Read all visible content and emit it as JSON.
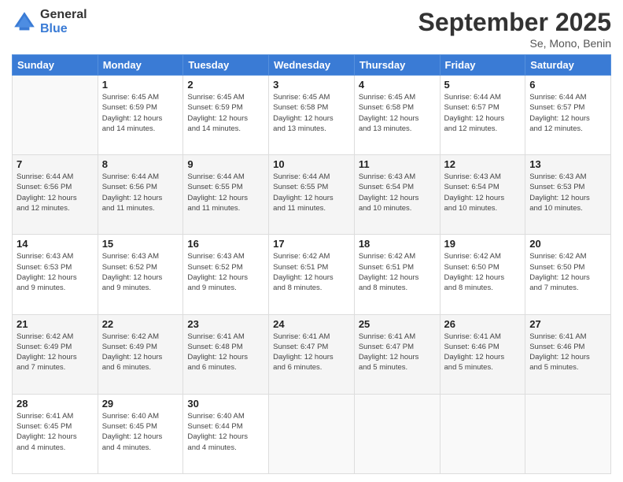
{
  "logo": {
    "general": "General",
    "blue": "Blue"
  },
  "header": {
    "month": "September 2025",
    "location": "Se, Mono, Benin"
  },
  "weekdays": [
    "Sunday",
    "Monday",
    "Tuesday",
    "Wednesday",
    "Thursday",
    "Friday",
    "Saturday"
  ],
  "weeks": [
    [
      {
        "day": "",
        "info": ""
      },
      {
        "day": "1",
        "info": "Sunrise: 6:45 AM\nSunset: 6:59 PM\nDaylight: 12 hours\nand 14 minutes."
      },
      {
        "day": "2",
        "info": "Sunrise: 6:45 AM\nSunset: 6:59 PM\nDaylight: 12 hours\nand 14 minutes."
      },
      {
        "day": "3",
        "info": "Sunrise: 6:45 AM\nSunset: 6:58 PM\nDaylight: 12 hours\nand 13 minutes."
      },
      {
        "day": "4",
        "info": "Sunrise: 6:45 AM\nSunset: 6:58 PM\nDaylight: 12 hours\nand 13 minutes."
      },
      {
        "day": "5",
        "info": "Sunrise: 6:44 AM\nSunset: 6:57 PM\nDaylight: 12 hours\nand 12 minutes."
      },
      {
        "day": "6",
        "info": "Sunrise: 6:44 AM\nSunset: 6:57 PM\nDaylight: 12 hours\nand 12 minutes."
      }
    ],
    [
      {
        "day": "7",
        "info": "Sunrise: 6:44 AM\nSunset: 6:56 PM\nDaylight: 12 hours\nand 12 minutes."
      },
      {
        "day": "8",
        "info": "Sunrise: 6:44 AM\nSunset: 6:56 PM\nDaylight: 12 hours\nand 11 minutes."
      },
      {
        "day": "9",
        "info": "Sunrise: 6:44 AM\nSunset: 6:55 PM\nDaylight: 12 hours\nand 11 minutes."
      },
      {
        "day": "10",
        "info": "Sunrise: 6:44 AM\nSunset: 6:55 PM\nDaylight: 12 hours\nand 11 minutes."
      },
      {
        "day": "11",
        "info": "Sunrise: 6:43 AM\nSunset: 6:54 PM\nDaylight: 12 hours\nand 10 minutes."
      },
      {
        "day": "12",
        "info": "Sunrise: 6:43 AM\nSunset: 6:54 PM\nDaylight: 12 hours\nand 10 minutes."
      },
      {
        "day": "13",
        "info": "Sunrise: 6:43 AM\nSunset: 6:53 PM\nDaylight: 12 hours\nand 10 minutes."
      }
    ],
    [
      {
        "day": "14",
        "info": "Sunrise: 6:43 AM\nSunset: 6:53 PM\nDaylight: 12 hours\nand 9 minutes."
      },
      {
        "day": "15",
        "info": "Sunrise: 6:43 AM\nSunset: 6:52 PM\nDaylight: 12 hours\nand 9 minutes."
      },
      {
        "day": "16",
        "info": "Sunrise: 6:43 AM\nSunset: 6:52 PM\nDaylight: 12 hours\nand 9 minutes."
      },
      {
        "day": "17",
        "info": "Sunrise: 6:42 AM\nSunset: 6:51 PM\nDaylight: 12 hours\nand 8 minutes."
      },
      {
        "day": "18",
        "info": "Sunrise: 6:42 AM\nSunset: 6:51 PM\nDaylight: 12 hours\nand 8 minutes."
      },
      {
        "day": "19",
        "info": "Sunrise: 6:42 AM\nSunset: 6:50 PM\nDaylight: 12 hours\nand 8 minutes."
      },
      {
        "day": "20",
        "info": "Sunrise: 6:42 AM\nSunset: 6:50 PM\nDaylight: 12 hours\nand 7 minutes."
      }
    ],
    [
      {
        "day": "21",
        "info": "Sunrise: 6:42 AM\nSunset: 6:49 PM\nDaylight: 12 hours\nand 7 minutes."
      },
      {
        "day": "22",
        "info": "Sunrise: 6:42 AM\nSunset: 6:49 PM\nDaylight: 12 hours\nand 6 minutes."
      },
      {
        "day": "23",
        "info": "Sunrise: 6:41 AM\nSunset: 6:48 PM\nDaylight: 12 hours\nand 6 minutes."
      },
      {
        "day": "24",
        "info": "Sunrise: 6:41 AM\nSunset: 6:47 PM\nDaylight: 12 hours\nand 6 minutes."
      },
      {
        "day": "25",
        "info": "Sunrise: 6:41 AM\nSunset: 6:47 PM\nDaylight: 12 hours\nand 5 minutes."
      },
      {
        "day": "26",
        "info": "Sunrise: 6:41 AM\nSunset: 6:46 PM\nDaylight: 12 hours\nand 5 minutes."
      },
      {
        "day": "27",
        "info": "Sunrise: 6:41 AM\nSunset: 6:46 PM\nDaylight: 12 hours\nand 5 minutes."
      }
    ],
    [
      {
        "day": "28",
        "info": "Sunrise: 6:41 AM\nSunset: 6:45 PM\nDaylight: 12 hours\nand 4 minutes."
      },
      {
        "day": "29",
        "info": "Sunrise: 6:40 AM\nSunset: 6:45 PM\nDaylight: 12 hours\nand 4 minutes."
      },
      {
        "day": "30",
        "info": "Sunrise: 6:40 AM\nSunset: 6:44 PM\nDaylight: 12 hours\nand 4 minutes."
      },
      {
        "day": "",
        "info": ""
      },
      {
        "day": "",
        "info": ""
      },
      {
        "day": "",
        "info": ""
      },
      {
        "day": "",
        "info": ""
      }
    ]
  ]
}
